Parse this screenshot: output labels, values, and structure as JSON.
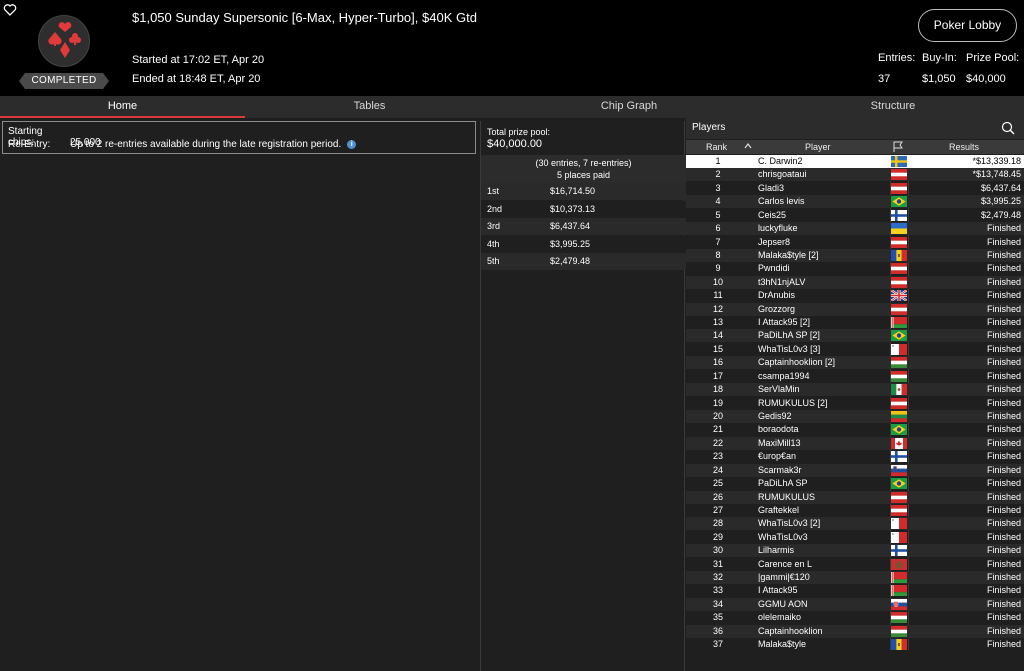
{
  "header": {
    "title": "$1,050 Sunday Supersonic [6-Max, Hyper-Turbo], $40K Gtd",
    "started": "Started at 17:02 ET, Apr 20",
    "ended": "Ended at 18:48 ET, Apr 20",
    "status_badge": "COMPLETED",
    "lobby_button": "Poker Lobby",
    "stats": {
      "entries_label": "Entries:",
      "entries_value": "37",
      "buyin_label": "Buy-In:",
      "buyin_value": "$1,050",
      "prize_label": "Prize Pool:",
      "prize_value": "$40,000"
    },
    "logo_color": "#e03a3a"
  },
  "tabs": [
    {
      "label": "Home",
      "active": true
    },
    {
      "label": "Tables",
      "active": false
    },
    {
      "label": "Chip Graph",
      "active": false
    },
    {
      "label": "Structure",
      "active": false
    }
  ],
  "info": {
    "starting_chips_label": "Starting chips:",
    "starting_chips_value": "25,000",
    "reentry_label": "Re-Entry:",
    "reentry_value": "Up to 2 re-entries available during the late registration period.",
    "info_icon_glyph": "i"
  },
  "prizes": {
    "total_label": "Total prize pool:",
    "total_value": "$40,000.00",
    "entries_note": "(30 entries, 7 re-entries)",
    "places_note": "5 places paid",
    "payouts": [
      {
        "place": "1st",
        "amount": "$16,714.50"
      },
      {
        "place": "2nd",
        "amount": "$10,373.13"
      },
      {
        "place": "3rd",
        "amount": "$6,437.64"
      },
      {
        "place": "4th",
        "amount": "$3,995.25"
      },
      {
        "place": "5th",
        "amount": "$2,479.48"
      }
    ]
  },
  "players": {
    "title": "Players",
    "columns": {
      "rank": "Rank",
      "player": "Player",
      "results": "Results"
    },
    "rows": [
      {
        "rank": "1",
        "name": "C. Darwin2",
        "flag": "SE",
        "result": "*$13,339.18"
      },
      {
        "rank": "2",
        "name": "chrisgoataui",
        "flag": "AT",
        "result": "*$13,748.45"
      },
      {
        "rank": "3",
        "name": "Gladi3",
        "flag": "AT",
        "result": "$6,437.64"
      },
      {
        "rank": "4",
        "name": "Carlos levis",
        "flag": "BR",
        "result": "$3,995.25"
      },
      {
        "rank": "5",
        "name": "Ceis25",
        "flag": "FI",
        "result": "$2,479.48"
      },
      {
        "rank": "6",
        "name": "luckyfluke",
        "flag": "UA",
        "result": "Finished"
      },
      {
        "rank": "7",
        "name": "Jepser8",
        "flag": "AT",
        "result": "Finished"
      },
      {
        "rank": "8",
        "name": "Malaka$tyle [2]",
        "flag": "MD",
        "result": "Finished"
      },
      {
        "rank": "9",
        "name": "Pwndidi",
        "flag": "AT",
        "result": "Finished"
      },
      {
        "rank": "10",
        "name": "t3hN1njALV",
        "flag": "AT",
        "result": "Finished"
      },
      {
        "rank": "11",
        "name": "DrAnubis",
        "flag": "GB",
        "result": "Finished"
      },
      {
        "rank": "12",
        "name": "Grozzorg",
        "flag": "AT",
        "result": "Finished"
      },
      {
        "rank": "13",
        "name": "I Attack95 [2]",
        "flag": "BY",
        "result": "Finished"
      },
      {
        "rank": "14",
        "name": "PaDiLhA SP [2]",
        "flag": "BR",
        "result": "Finished"
      },
      {
        "rank": "15",
        "name": "WhaTisL0v3 [3]",
        "flag": "MT",
        "result": "Finished"
      },
      {
        "rank": "16",
        "name": "Captainhooklion [2]",
        "flag": "HU",
        "result": "Finished"
      },
      {
        "rank": "17",
        "name": "csampa1994",
        "flag": "HU",
        "result": "Finished"
      },
      {
        "rank": "18",
        "name": "SerVlaMin",
        "flag": "MX",
        "result": "Finished"
      },
      {
        "rank": "19",
        "name": "RUMUKULUS [2]",
        "flag": "AT",
        "result": "Finished"
      },
      {
        "rank": "20",
        "name": "Gedis92",
        "flag": "LT",
        "result": "Finished"
      },
      {
        "rank": "21",
        "name": "boraodota",
        "flag": "BR",
        "result": "Finished"
      },
      {
        "rank": "22",
        "name": "MaxiMill13",
        "flag": "CA",
        "result": "Finished"
      },
      {
        "rank": "23",
        "name": "€urop€an",
        "flag": "FI",
        "result": "Finished"
      },
      {
        "rank": "24",
        "name": "Scarmak3r",
        "flag": "SI",
        "result": "Finished"
      },
      {
        "rank": "25",
        "name": "PaDiLhA SP",
        "flag": "BR",
        "result": "Finished"
      },
      {
        "rank": "26",
        "name": "RUMUKULUS",
        "flag": "AT",
        "result": "Finished"
      },
      {
        "rank": "27",
        "name": "Graftekkel",
        "flag": "AT",
        "result": "Finished"
      },
      {
        "rank": "28",
        "name": "WhaTisL0v3 [2]",
        "flag": "MT",
        "result": "Finished"
      },
      {
        "rank": "29",
        "name": "WhaTisL0v3",
        "flag": "MT",
        "result": "Finished"
      },
      {
        "rank": "30",
        "name": "Lilharmis",
        "flag": "FI",
        "result": "Finished"
      },
      {
        "rank": "31",
        "name": "Carence en L",
        "flag": "MA",
        "result": "Finished"
      },
      {
        "rank": "32",
        "name": "|gammi|€120",
        "flag": "BY",
        "result": "Finished"
      },
      {
        "rank": "33",
        "name": "I Attack95",
        "flag": "BY",
        "result": "Finished"
      },
      {
        "rank": "34",
        "name": "GGMU AON",
        "flag": "SK",
        "result": "Finished"
      },
      {
        "rank": "35",
        "name": "olelemaiko",
        "flag": "HU",
        "result": "Finished"
      },
      {
        "rank": "36",
        "name": "Captainhooklion",
        "flag": "HU",
        "result": "Finished"
      },
      {
        "rank": "37",
        "name": "Malaka$tyle",
        "flag": "MD",
        "result": "Finished"
      }
    ]
  }
}
